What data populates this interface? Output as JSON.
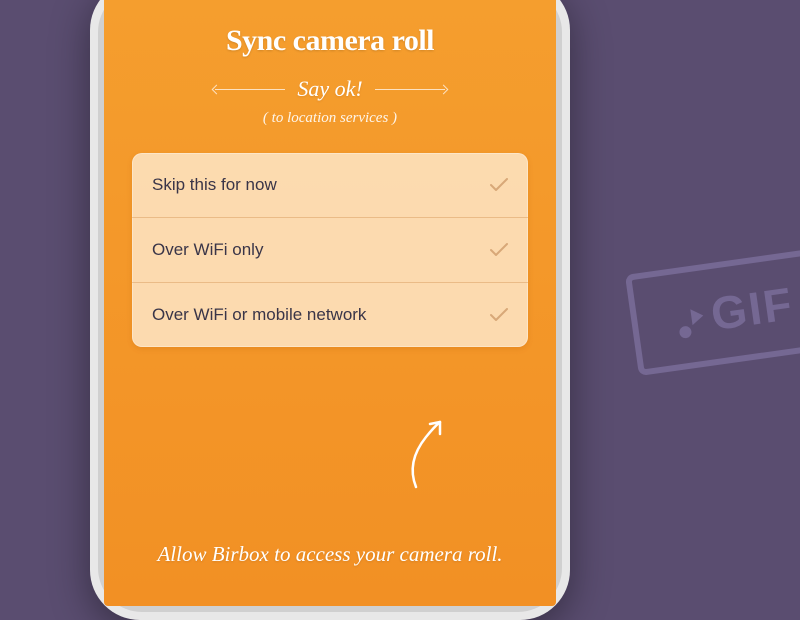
{
  "screen": {
    "title": "Sync camera roll",
    "subtitle": "Say ok!",
    "subnote": "( to location services )",
    "options": [
      {
        "label": "Skip this for now"
      },
      {
        "label": "Over WiFi only"
      },
      {
        "label": "Over WiFi or mobile network"
      }
    ],
    "footer_hint": "Allow Birbox to access your camera roll."
  },
  "badge": {
    "text": "GIF"
  }
}
